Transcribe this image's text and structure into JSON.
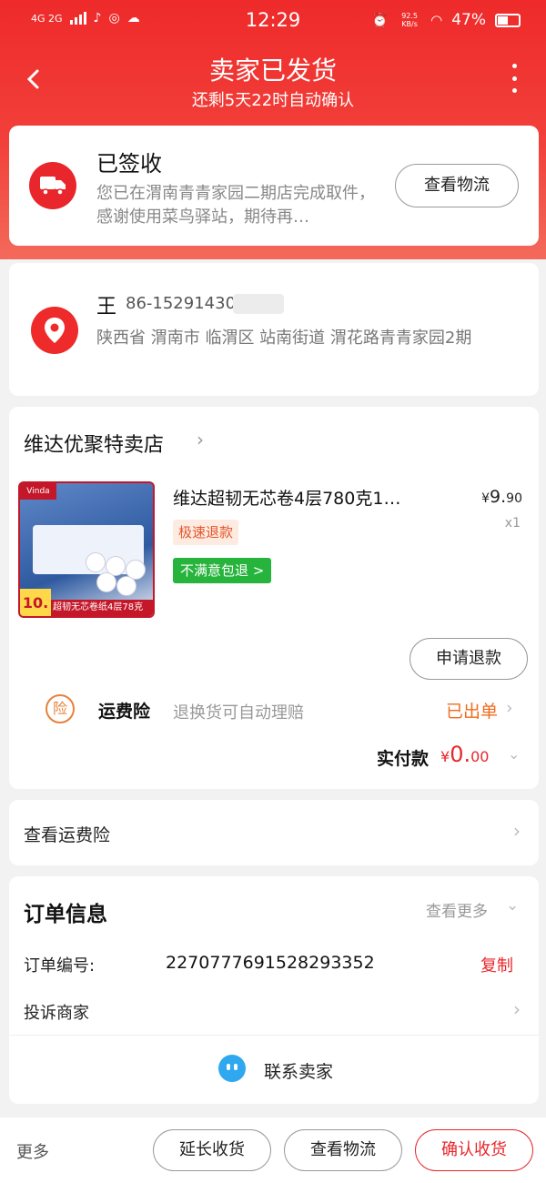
{
  "status_bar": {
    "network": "4G 2G",
    "time": "12:29",
    "net_speed": "92.5 KB/s",
    "battery": "47%"
  },
  "header": {
    "title": "卖家已发货",
    "subtitle": "还剩5天22时自动确认"
  },
  "delivery": {
    "status": "已签收",
    "description": "您已在渭南青青家园二期店完成取件，感谢使用菜鸟驿站，期待再…",
    "track_button": "查看物流"
  },
  "address": {
    "name": "王",
    "phone": "86-15291430",
    "detail": "陕西省 渭南市 临渭区 站南街道 渭花路青青家园2期"
  },
  "order": {
    "store_name": "维达优聚特卖店",
    "product": {
      "title": "维达超韧无芯卷4层780克1…",
      "price_symbol": "¥",
      "price_int": "9.",
      "price_dec": "90",
      "quantity": "x1",
      "tag_refund": "极速退款",
      "tag_return": "不满意包退 >",
      "image_brand": "Vinda",
      "image_banner": "超韧无芯卷纸4层78克",
      "image_price": "10."
    },
    "refund_button": "申请退款",
    "insurance": {
      "badge": "险",
      "label": "运费险",
      "description": "退换货可自动理赔",
      "status": "已出单"
    },
    "paid": {
      "label": "实付款",
      "symbol": "¥",
      "int": "0.",
      "dec": "00"
    }
  },
  "insurance_row": {
    "label": "查看运费险"
  },
  "order_info": {
    "title": "订单信息",
    "more": "查看更多",
    "order_no_label": "订单编号:",
    "order_no": "2270777691528293352",
    "copy": "复制",
    "complain": "投诉商家",
    "contact": "联系卖家"
  },
  "bottom_bar": {
    "more": "更多",
    "extend": "延长收货",
    "track": "查看物流",
    "confirm": "确认收货"
  },
  "colors": {
    "brand_red": "#e8262b",
    "refund_tag": "#e5562a",
    "return_tag": "#26b43c",
    "insurance_orange": "#f26b1d",
    "contact_blue": "#2fa8f0"
  }
}
